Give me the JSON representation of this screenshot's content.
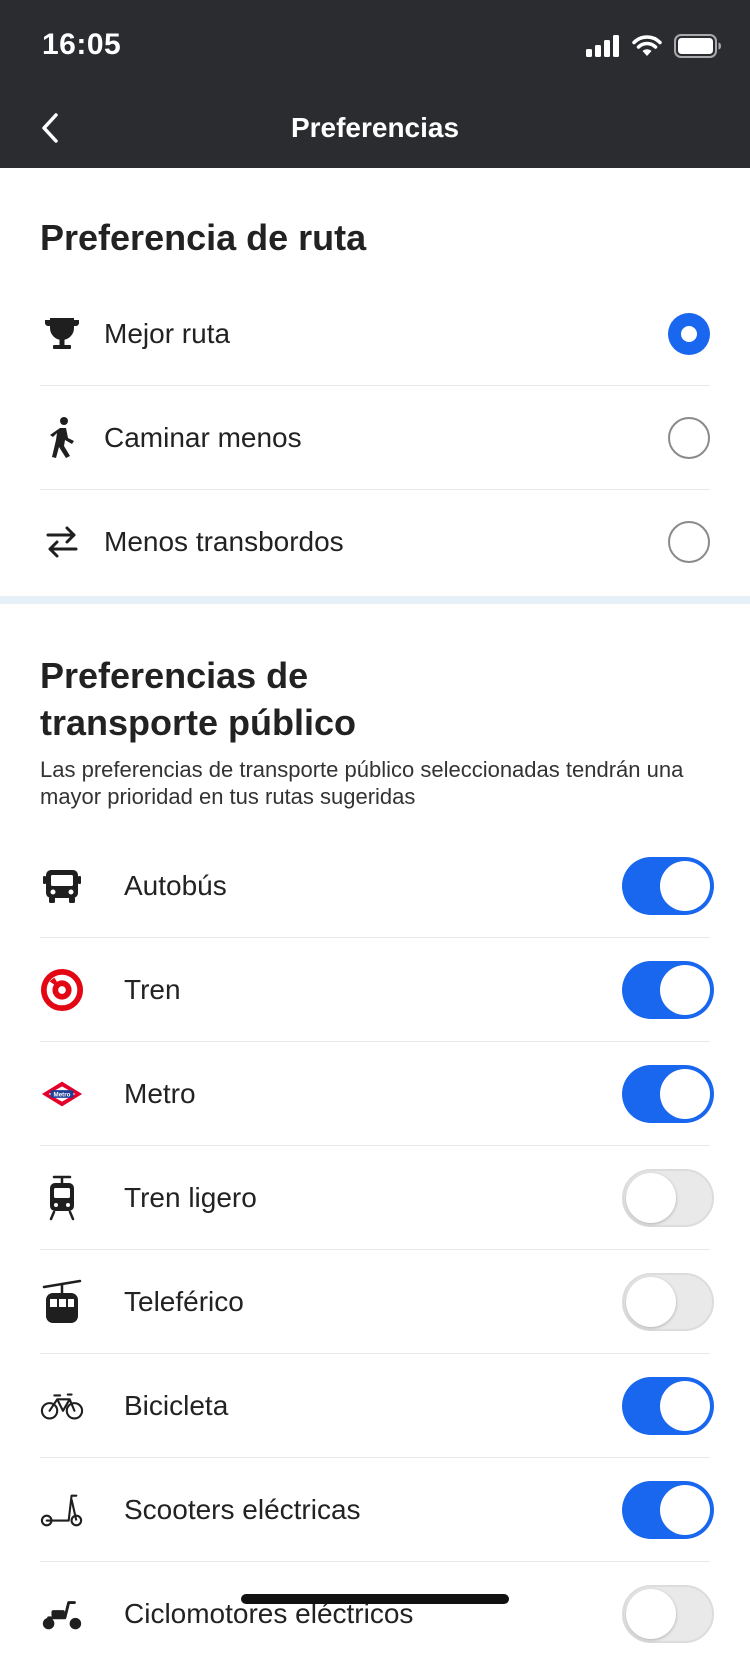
{
  "status": {
    "time": "16:05"
  },
  "nav": {
    "title": "Preferencias"
  },
  "route_section": {
    "title": "Preferencia de ruta",
    "options": [
      {
        "label": "Mejor ruta",
        "icon": "trophy-icon",
        "selected": true
      },
      {
        "label": "Caminar menos",
        "icon": "walk-icon",
        "selected": false
      },
      {
        "label": "Menos transbordos",
        "icon": "transfer-icon",
        "selected": false
      }
    ]
  },
  "transport_section": {
    "title_line1": "Preferencias de",
    "title_line2": "transporte público",
    "description": "Las preferencias de transporte público seleccionadas tendrán una mayor prioridad en tus rutas sugeridas",
    "modes": [
      {
        "label": "Autobús",
        "icon": "bus-icon",
        "enabled": true
      },
      {
        "label": "Tren",
        "icon": "train-icon",
        "enabled": true
      },
      {
        "label": "Metro",
        "icon": "metro-icon",
        "enabled": true,
        "icon_text": "Metro"
      },
      {
        "label": "Tren ligero",
        "icon": "light-rail-icon",
        "enabled": false
      },
      {
        "label": "Teleférico",
        "icon": "cable-car-icon",
        "enabled": false
      },
      {
        "label": "Bicicleta",
        "icon": "bicycle-icon",
        "enabled": true
      },
      {
        "label": "Scooters eléctricas",
        "icon": "scooter-icon",
        "enabled": true
      },
      {
        "label": "Ciclomotores eléctricos",
        "icon": "moped-icon",
        "enabled": false
      }
    ]
  },
  "colors": {
    "accent": "#1967ee",
    "topbar": "#2b2c30",
    "divider": "#e6f0f8",
    "train_red": "#e30613",
    "metro_red": "#e4002b",
    "metro_blue": "#1f3f99"
  }
}
